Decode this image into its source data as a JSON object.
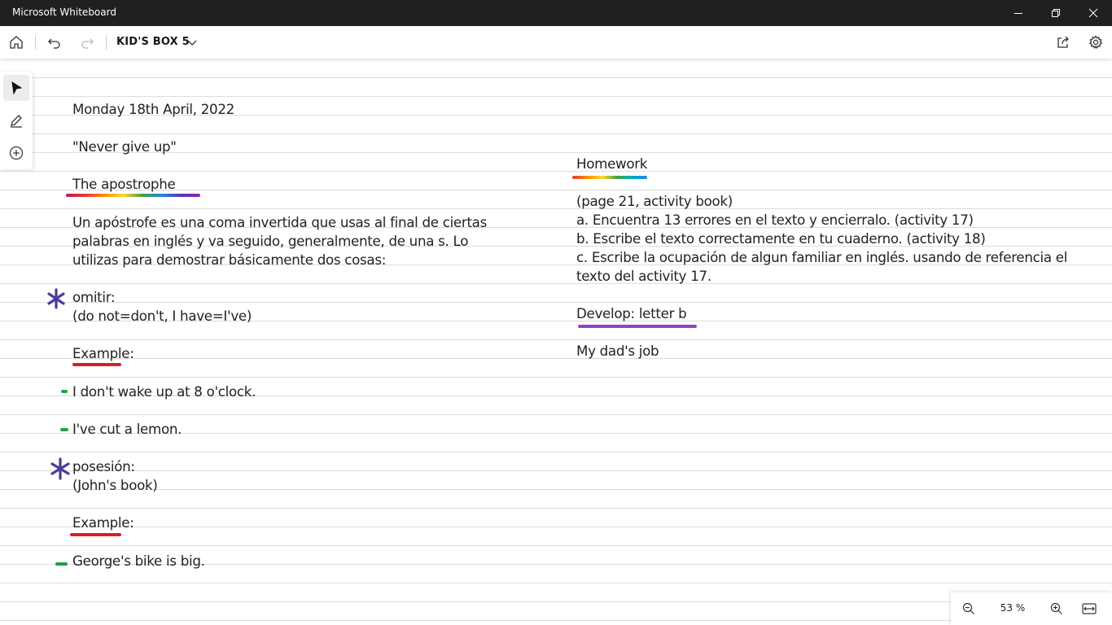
{
  "window": {
    "title": "Microsoft Whiteboard"
  },
  "toolbar": {
    "board_title": "KID'S BOX 5"
  },
  "zoom": {
    "level": "53 %"
  },
  "icons": {
    "home": "home-icon",
    "undo": "undo-icon",
    "redo": "redo-icon",
    "share": "share-icon",
    "settings": "gear-icon",
    "select": "select-arrow-icon",
    "pen": "pen-icon",
    "add": "add-circle-icon",
    "zoom_out": "zoom-out-icon",
    "zoom_in": "zoom-in-icon",
    "fit": "fit-to-screen-icon"
  },
  "colors": {
    "titlebar": "#202020",
    "ink": "#222222",
    "red_underline": "#d61f2c",
    "purple_underline": "#8e44c4",
    "green_dash": "#1fa04a",
    "star": "#4a3c9a"
  },
  "notes": {
    "date": "Monday 18th April, 2022",
    "quote": "\"Never give up\"",
    "heading": "The apostrophe",
    "intro": [
      "Un apóstrofe es una coma invertida que usas al final de ciertas",
      "palabras en inglés y va seguido, generalmente, de una s. Lo",
      "utilizas para demostrar básicamente dos cosas:"
    ],
    "omit_label": "omitir:",
    "omit_examples": "(do not=don't, I have=I've)",
    "example_label_1": "Example:",
    "example_1a": "I don't wake up at 8 o'clock.",
    "example_1b": "I've cut a lemon.",
    "possession_label": "posesión:",
    "possession_example": "(John's book)",
    "example_label_2": "Example:",
    "example_2": "George's bike is big."
  },
  "homework": {
    "heading": "Homework",
    "lines": [
      "(page 21, activity book)",
      "a. Encuentra 13 errores en el texto y encierralo. (activity 17)",
      "b. Escribe el texto correctamente en tu cuaderno.  (activity 18)",
      "c. Escribe la ocupación de algun familiar en inglés. usando de referencia el",
      "texto del activity 17."
    ],
    "develop": "Develop: letter b",
    "task": "My dad's job"
  }
}
